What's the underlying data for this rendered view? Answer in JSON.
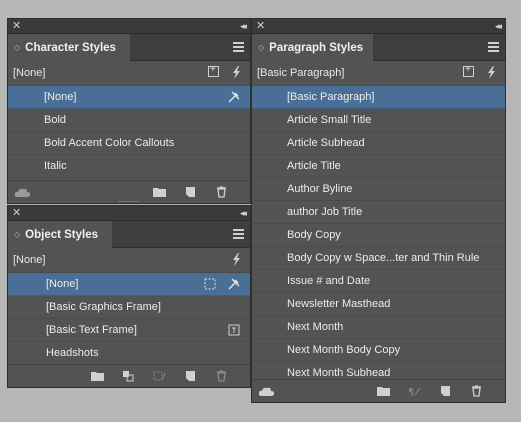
{
  "character_styles": {
    "title": "Character Styles",
    "current": "[None]",
    "items": [
      "[None]",
      "Bold",
      "Bold Accent Color Callouts",
      "Italic"
    ]
  },
  "object_styles": {
    "title": "Object Styles",
    "current": "[None]",
    "items": [
      "[None]",
      "[Basic Graphics Frame]",
      "[Basic Text Frame]",
      "Headshots"
    ]
  },
  "paragraph_styles": {
    "title": "Paragraph Styles",
    "current": "[Basic Paragraph]",
    "items": [
      "[Basic Paragraph]",
      "Article Small Title",
      "Article Subhead",
      "Article Title",
      "Author Byline",
      "author Job Title",
      "Body Copy",
      "Body Copy w Space...ter and Thin Rule",
      "Issue # and Date",
      "Newsletter Masthead",
      "Next Month",
      "Next Month Body Copy",
      "Next Month Subhead"
    ]
  },
  "colors": {
    "selection": "#4a6f96",
    "panel": "#535353",
    "background": "#b6b6b6"
  }
}
